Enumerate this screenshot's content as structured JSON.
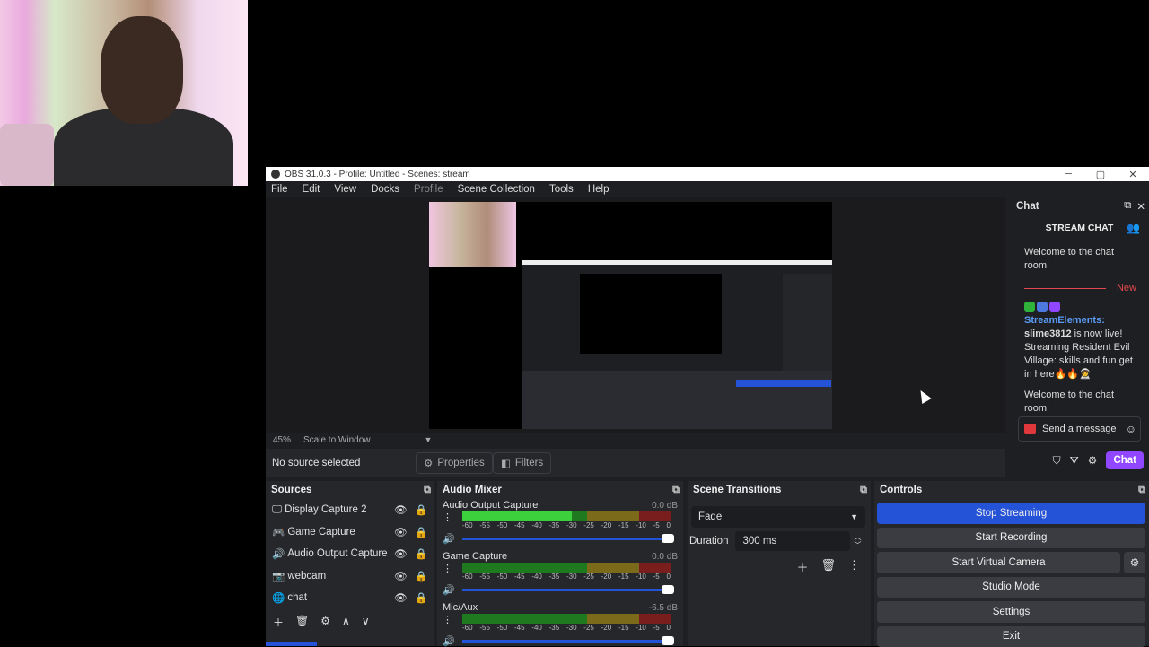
{
  "titlebar": {
    "title": "OBS 31.0.3 - Profile: Untitled - Scenes: stream",
    "minimize": "─",
    "maximize": "▢",
    "close": "✕"
  },
  "menu": [
    "File",
    "Edit",
    "View",
    "Docks",
    "Profile",
    "Scene Collection",
    "Tools",
    "Help"
  ],
  "preview": {
    "zoom": "45%",
    "scale_mode": "Scale to Window",
    "dropdown_arrow": "▼"
  },
  "source_toolbar": {
    "no_source": "No source selected",
    "properties": "Properties",
    "filters": "Filters"
  },
  "chat": {
    "title": "Chat",
    "header": "STREAM CHAT",
    "welcome1": "Welcome to the chat room!",
    "new_label": "New",
    "sender": "StreamElements:",
    "user": "slime3812",
    "message": " is now live! Streaming Resident Evil Village: skills and fun get in here🔥🔥👨‍🚀",
    "welcome2": "Welcome to the chat room!",
    "input_placeholder": "Send a message",
    "chat_button": "Chat",
    "accent": "#9147ff"
  },
  "sources": {
    "title": "Sources",
    "items": [
      {
        "icon": "🖵",
        "label": "Display Capture 2"
      },
      {
        "icon": "🎮",
        "label": "Game Capture"
      },
      {
        "icon": "🔊",
        "label": "Audio Output Capture"
      },
      {
        "icon": "📷",
        "label": "webcam"
      },
      {
        "icon": "🌐",
        "label": "chat"
      }
    ]
  },
  "mixer": {
    "title": "Audio Mixer",
    "ticks": [
      "-60",
      "-55",
      "-50",
      "-45",
      "-40",
      "-35",
      "-30",
      "-25",
      "-20",
      "-15",
      "-10",
      "-5",
      "0"
    ],
    "channels": [
      {
        "name": "Audio Output Capture",
        "db": "0.0 dB",
        "level": 0.88
      },
      {
        "name": "Game Capture",
        "db": "0.0 dB",
        "level": 0.0
      },
      {
        "name": "Mic/Aux",
        "db": "-6.5 dB",
        "level": 0.0
      }
    ]
  },
  "transitions": {
    "title": "Scene Transitions",
    "selected": "Fade",
    "duration_label": "Duration",
    "duration_value": "300 ms"
  },
  "controls": {
    "title": "Controls",
    "stop_streaming": "Stop Streaming",
    "start_recording": "Start Recording",
    "start_virtual_camera": "Start Virtual Camera",
    "studio_mode": "Studio Mode",
    "settings": "Settings",
    "exit": "Exit"
  }
}
